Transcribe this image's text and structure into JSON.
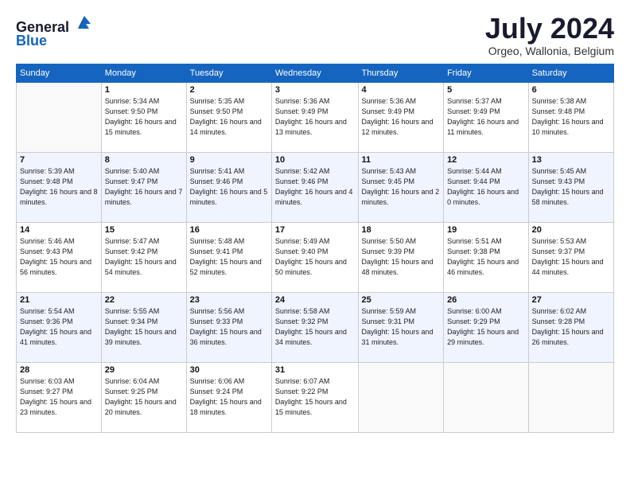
{
  "header": {
    "logo_line1": "General",
    "logo_line2": "Blue",
    "month": "July 2024",
    "location": "Orgeo, Wallonia, Belgium"
  },
  "days_of_week": [
    "Sunday",
    "Monday",
    "Tuesday",
    "Wednesday",
    "Thursday",
    "Friday",
    "Saturday"
  ],
  "weeks": [
    [
      {
        "day": "",
        "info": ""
      },
      {
        "day": "1",
        "info": "Sunrise: 5:34 AM\nSunset: 9:50 PM\nDaylight: 16 hours\nand 15 minutes."
      },
      {
        "day": "2",
        "info": "Sunrise: 5:35 AM\nSunset: 9:50 PM\nDaylight: 16 hours\nand 14 minutes."
      },
      {
        "day": "3",
        "info": "Sunrise: 5:36 AM\nSunset: 9:49 PM\nDaylight: 16 hours\nand 13 minutes."
      },
      {
        "day": "4",
        "info": "Sunrise: 5:36 AM\nSunset: 9:49 PM\nDaylight: 16 hours\nand 12 minutes."
      },
      {
        "day": "5",
        "info": "Sunrise: 5:37 AM\nSunset: 9:49 PM\nDaylight: 16 hours\nand 11 minutes."
      },
      {
        "day": "6",
        "info": "Sunrise: 5:38 AM\nSunset: 9:48 PM\nDaylight: 16 hours\nand 10 minutes."
      }
    ],
    [
      {
        "day": "7",
        "info": "Sunrise: 5:39 AM\nSunset: 9:48 PM\nDaylight: 16 hours\nand 8 minutes."
      },
      {
        "day": "8",
        "info": "Sunrise: 5:40 AM\nSunset: 9:47 PM\nDaylight: 16 hours\nand 7 minutes."
      },
      {
        "day": "9",
        "info": "Sunrise: 5:41 AM\nSunset: 9:46 PM\nDaylight: 16 hours\nand 5 minutes."
      },
      {
        "day": "10",
        "info": "Sunrise: 5:42 AM\nSunset: 9:46 PM\nDaylight: 16 hours\nand 4 minutes."
      },
      {
        "day": "11",
        "info": "Sunrise: 5:43 AM\nSunset: 9:45 PM\nDaylight: 16 hours\nand 2 minutes."
      },
      {
        "day": "12",
        "info": "Sunrise: 5:44 AM\nSunset: 9:44 PM\nDaylight: 16 hours\nand 0 minutes."
      },
      {
        "day": "13",
        "info": "Sunrise: 5:45 AM\nSunset: 9:43 PM\nDaylight: 15 hours\nand 58 minutes."
      }
    ],
    [
      {
        "day": "14",
        "info": "Sunrise: 5:46 AM\nSunset: 9:43 PM\nDaylight: 15 hours\nand 56 minutes."
      },
      {
        "day": "15",
        "info": "Sunrise: 5:47 AM\nSunset: 9:42 PM\nDaylight: 15 hours\nand 54 minutes."
      },
      {
        "day": "16",
        "info": "Sunrise: 5:48 AM\nSunset: 9:41 PM\nDaylight: 15 hours\nand 52 minutes."
      },
      {
        "day": "17",
        "info": "Sunrise: 5:49 AM\nSunset: 9:40 PM\nDaylight: 15 hours\nand 50 minutes."
      },
      {
        "day": "18",
        "info": "Sunrise: 5:50 AM\nSunset: 9:39 PM\nDaylight: 15 hours\nand 48 minutes."
      },
      {
        "day": "19",
        "info": "Sunrise: 5:51 AM\nSunset: 9:38 PM\nDaylight: 15 hours\nand 46 minutes."
      },
      {
        "day": "20",
        "info": "Sunrise: 5:53 AM\nSunset: 9:37 PM\nDaylight: 15 hours\nand 44 minutes."
      }
    ],
    [
      {
        "day": "21",
        "info": "Sunrise: 5:54 AM\nSunset: 9:36 PM\nDaylight: 15 hours\nand 41 minutes."
      },
      {
        "day": "22",
        "info": "Sunrise: 5:55 AM\nSunset: 9:34 PM\nDaylight: 15 hours\nand 39 minutes."
      },
      {
        "day": "23",
        "info": "Sunrise: 5:56 AM\nSunset: 9:33 PM\nDaylight: 15 hours\nand 36 minutes."
      },
      {
        "day": "24",
        "info": "Sunrise: 5:58 AM\nSunset: 9:32 PM\nDaylight: 15 hours\nand 34 minutes."
      },
      {
        "day": "25",
        "info": "Sunrise: 5:59 AM\nSunset: 9:31 PM\nDaylight: 15 hours\nand 31 minutes."
      },
      {
        "day": "26",
        "info": "Sunrise: 6:00 AM\nSunset: 9:29 PM\nDaylight: 15 hours\nand 29 minutes."
      },
      {
        "day": "27",
        "info": "Sunrise: 6:02 AM\nSunset: 9:28 PM\nDaylight: 15 hours\nand 26 minutes."
      }
    ],
    [
      {
        "day": "28",
        "info": "Sunrise: 6:03 AM\nSunset: 9:27 PM\nDaylight: 15 hours\nand 23 minutes."
      },
      {
        "day": "29",
        "info": "Sunrise: 6:04 AM\nSunset: 9:25 PM\nDaylight: 15 hours\nand 20 minutes."
      },
      {
        "day": "30",
        "info": "Sunrise: 6:06 AM\nSunset: 9:24 PM\nDaylight: 15 hours\nand 18 minutes."
      },
      {
        "day": "31",
        "info": "Sunrise: 6:07 AM\nSunset: 9:22 PM\nDaylight: 15 hours\nand 15 minutes."
      },
      {
        "day": "",
        "info": ""
      },
      {
        "day": "",
        "info": ""
      },
      {
        "day": "",
        "info": ""
      }
    ]
  ]
}
